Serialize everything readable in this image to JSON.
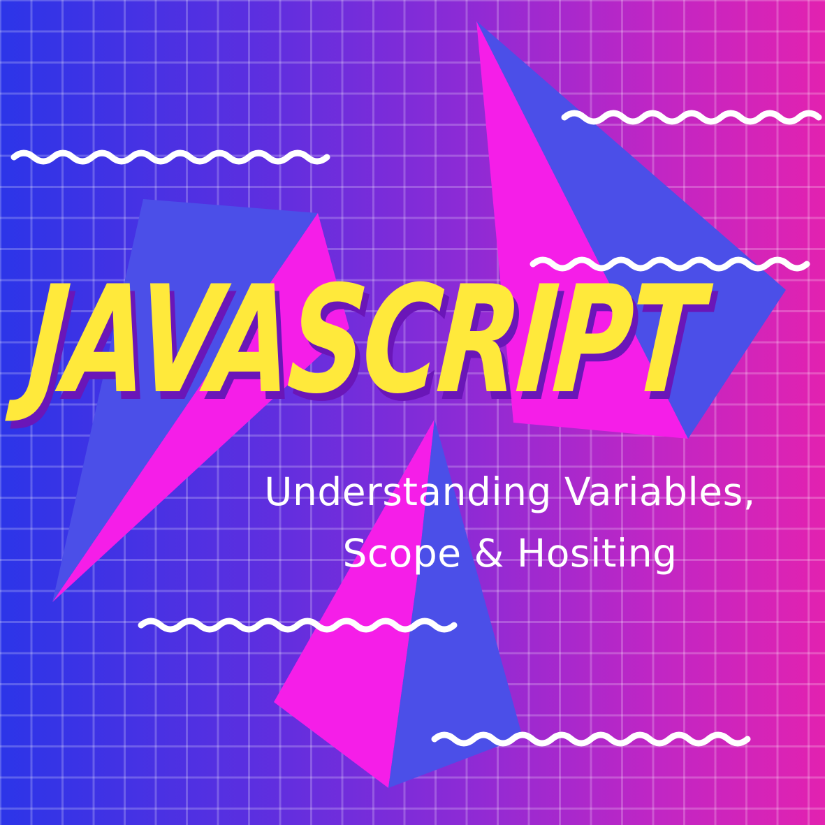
{
  "title": "JAVASCRIPT",
  "subtitle": {
    "line1": "Understanding Variables,",
    "line2": "Scope & Hositing"
  },
  "colors": {
    "background_left": "#2c35e8",
    "background_right": "#e222b0",
    "title_fill": "#ffe93b",
    "title_shadow": "#6a16b8",
    "shape_magenta": "#f51ee8",
    "shape_blue": "#4b4fe8",
    "squiggle": "#ffffff"
  }
}
